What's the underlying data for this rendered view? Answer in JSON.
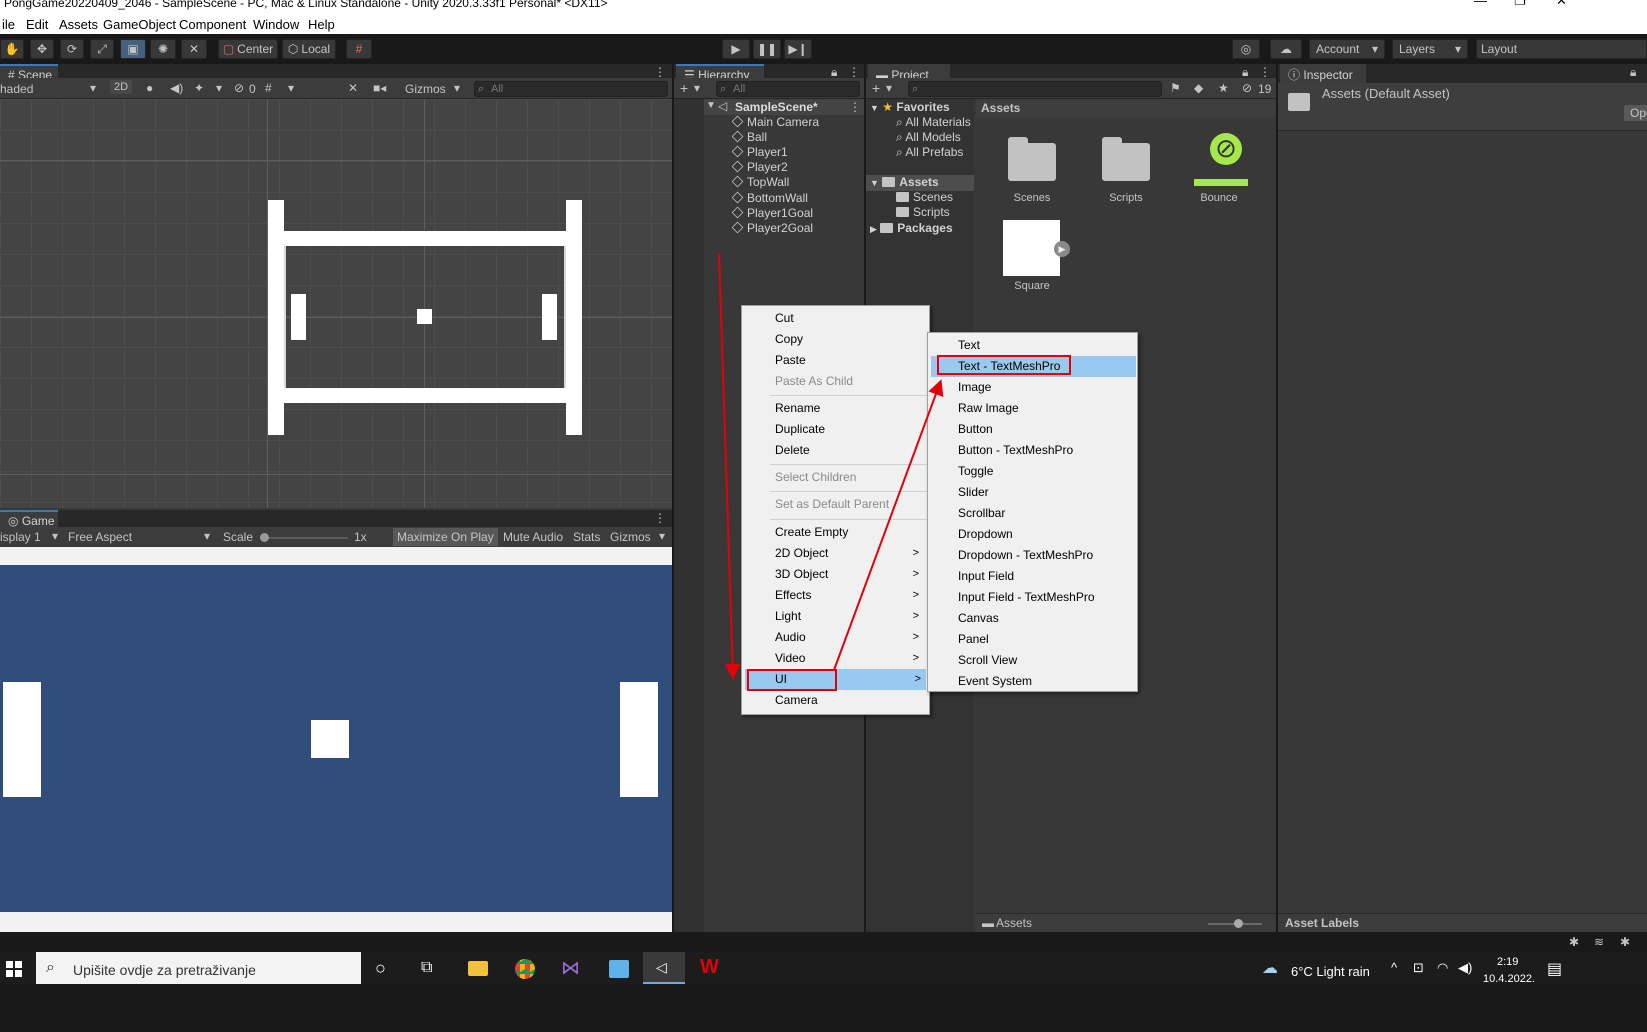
{
  "window": {
    "title": "PongGame20220409_2046 - SampleScene - PC, Mac & Linux Standalone - Unity 2020.3.33f1 Personal* <DX11>"
  },
  "menubar": [
    "ile",
    "Edit",
    "Assets",
    "GameObject",
    "Component",
    "Window",
    "Help"
  ],
  "toolbar": {
    "pivot": "Center",
    "space": "Local",
    "account": "Account",
    "layers": "Layers",
    "layout": "Layout"
  },
  "scene": {
    "tab": "Scene",
    "shading": "haded",
    "mode2d": "2D",
    "hidden_count": "0",
    "gizmos": "Gizmos",
    "search_placeholder": "All"
  },
  "game": {
    "tab": "Game",
    "display": "isplay 1",
    "aspect": "Free Aspect",
    "scale_label": "Scale",
    "scale_value": "1x",
    "maximize": "Maximize On Play",
    "mute": "Mute Audio",
    "stats": "Stats",
    "gizmos": "Gizmos"
  },
  "hierarchy": {
    "tab": "Hierarchy",
    "search_placeholder": "All",
    "scene_name": "SampleScene*",
    "items": [
      "Main Camera",
      "Ball",
      "Player1",
      "Player2",
      "TopWall",
      "BottomWall",
      "Player1Goal",
      "Player2Goal"
    ]
  },
  "project": {
    "tab": "Project",
    "hidden_count": "19",
    "favorites_label": "Favorites",
    "favorites": [
      "All Materials",
      "All Models",
      "All Prefabs"
    ],
    "assets_label": "Assets",
    "asset_folders": [
      "Scenes",
      "Scripts"
    ],
    "packages_label": "Packages",
    "breadcrumb": "Assets",
    "grid_items": [
      "Scenes",
      "Scripts",
      "Bounce",
      "Square"
    ],
    "footer_path": "Assets"
  },
  "inspector": {
    "tab": "Inspector",
    "header": "Assets (Default Asset)",
    "open_button": "Ope",
    "asset_labels": "Asset Labels"
  },
  "context_menu": {
    "items": [
      {
        "label": "Cut",
        "disabled": false
      },
      {
        "label": "Copy",
        "disabled": false
      },
      {
        "label": "Paste",
        "disabled": false
      },
      {
        "label": "Paste As Child",
        "disabled": true
      },
      {
        "label": "Rename",
        "disabled": false
      },
      {
        "label": "Duplicate",
        "disabled": false
      },
      {
        "label": "Delete",
        "disabled": false
      },
      {
        "label": "Select Children",
        "disabled": true
      },
      {
        "label": "Set as Default Parent",
        "disabled": true
      },
      {
        "label": "Create Empty",
        "disabled": false
      },
      {
        "label": "2D Object",
        "disabled": false
      },
      {
        "label": "3D Object",
        "disabled": false
      },
      {
        "label": "Effects",
        "disabled": false
      },
      {
        "label": "Light",
        "disabled": false
      },
      {
        "label": "Audio",
        "disabled": false
      },
      {
        "label": "Video",
        "disabled": false
      },
      {
        "label": "UI",
        "disabled": false
      },
      {
        "label": "Camera",
        "disabled": false
      }
    ],
    "submenu_arrow": ">"
  },
  "ui_submenu": {
    "items": [
      "Text",
      "Text - TextMeshPro",
      "Image",
      "Raw Image",
      "Button",
      "Button - TextMeshPro",
      "Toggle",
      "Slider",
      "Scrollbar",
      "Dropdown",
      "Dropdown - TextMeshPro",
      "Input Field",
      "Input Field - TextMeshPro",
      "Canvas",
      "Panel",
      "Scroll View",
      "Event System"
    ],
    "highlighted": "Text - TextMeshPro"
  },
  "taskbar": {
    "search_placeholder": "Upišite ovdje za pretraživanje",
    "weather": "6°C  Light rain",
    "time": "2:19",
    "date": "10.4.2022."
  },
  "colors": {
    "highlight": "#99c9ef",
    "annotation_red": "#e2000b",
    "game_bg": "#314d79",
    "bounce_green": "#a4e84c"
  }
}
